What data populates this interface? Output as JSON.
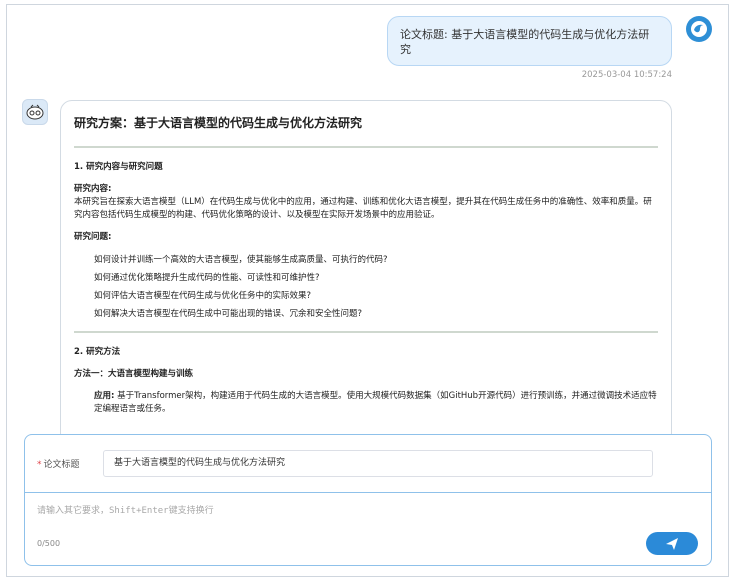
{
  "user_message": {
    "text": "论文标题: 基于大语言模型的代码生成与优化方法研究",
    "timestamp": "2025-03-04 10:57:24"
  },
  "answer": {
    "title": "研究方案：基于大语言模型的代码生成与优化方法研究",
    "section1": {
      "heading": "1. 研究内容与研究问题",
      "content_label": "研究内容:",
      "content_text": "本研究旨在探索大语言模型（LLM）在代码生成与优化中的应用，通过构建、训练和优化大语言模型，提升其在代码生成任务中的准确性、效率和质量。研究内容包括代码生成模型的构建、代码优化策略的设计、以及模型在实际开发场景中的应用验证。",
      "questions_label": "研究问题:",
      "questions": [
        "如何设计并训练一个高效的大语言模型，使其能够生成高质量、可执行的代码?",
        "如何通过优化策略提升生成代码的性能、可读性和可维护性?",
        "如何评估大语言模型在代码生成与优化任务中的实际效果?",
        "如何解决大语言模型在代码生成中可能出现的错误、冗余和安全性问题?"
      ]
    },
    "section2": {
      "heading": "2. 研究方法",
      "method1_label": "方法一：大语言模型构建与训练",
      "application_label": "应用:",
      "application_text": "基于Transformer架构，构建适用于代码生成的大语言模型。使用大规模代码数据集（如GitHub开源代码）进行预训练，并通过微调技术适应特定编程语言或任务。"
    }
  },
  "input_panel": {
    "field_label": "论文标题",
    "field_value": "基于大语言模型的代码生成与优化方法研究",
    "prompt_placeholder": "请输入其它要求，Shift+Enter键支持换行",
    "char_count": "0/500"
  },
  "icons": {
    "user_avatar": "bird-avatar-icon",
    "bot_avatar": "robot-avatar-icon",
    "send": "send-plane-icon"
  },
  "colors": {
    "accent": "#2b8ad8",
    "bubble_bg": "#e6f2fd",
    "required": "#e0454b"
  }
}
